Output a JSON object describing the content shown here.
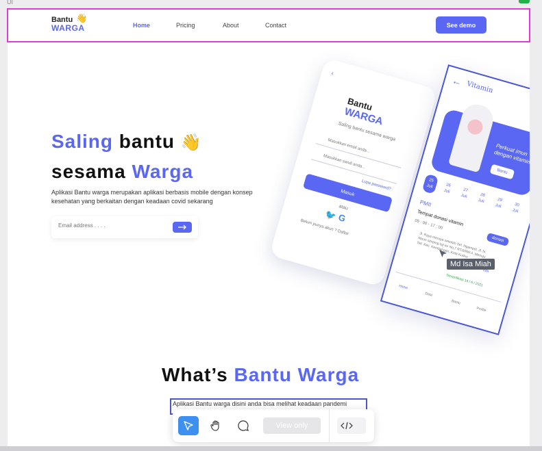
{
  "canvas": {
    "frame_label": "UI"
  },
  "nav": {
    "logo_line1": "Bantu",
    "logo_line2": "WARGA",
    "items": [
      {
        "label": "Home",
        "active": true
      },
      {
        "label": "Pricing",
        "active": false
      },
      {
        "label": "About",
        "active": false
      },
      {
        "label": "Contact",
        "active": false
      }
    ],
    "cta_label": "See demo"
  },
  "hero": {
    "title_part1": "Saling",
    "title_part2": "bantu",
    "title_part3": "sesama",
    "title_part4": "Warga",
    "description": "Aplikasi Bantu warga merupakan aplikasi berbasis mobile dengan konsep kesehatan yang berkaitan dengan keadaan covid sekarang",
    "email_placeholder": "Email address . . . ."
  },
  "phone_login": {
    "logo_line1": "Bantu",
    "logo_line2": "WARGA",
    "tagline": "Saling bantu sesama warga",
    "email_placeholder": "Masukkan email anda...",
    "password_placeholder": "Masukkan sandi anda...",
    "forgot": "Lupa password?",
    "submit": "Masuk",
    "or": "atau",
    "register": "Belum punya akun ? Daftar"
  },
  "phone_vitamin": {
    "title": "Vitamin",
    "banner_text": "Perkuat imun dengan vitamin",
    "banner_btn": "Bantu",
    "dates": [
      {
        "day": "25",
        "month": "Juli"
      },
      {
        "day": "26",
        "month": "Juli"
      },
      {
        "day": "27",
        "month": "Juli"
      },
      {
        "day": "28",
        "month": "Juli"
      },
      {
        "day": "29",
        "month": "Juli"
      },
      {
        "day": "30",
        "month": "Juli"
      }
    ],
    "org": "PMII",
    "card_title": "Tempat donasi vitamin",
    "time": "05 : 00 - 17 : 00",
    "address": "Jl. Raya merupa sekolah Sel. Ngampel, Jl. N. Moon simping loji lor No.7 RT.6/RW.4, Menuju Sel. Kec. Kembangan, Kota Kudus",
    "donate_btn": "donasi",
    "edit": "edit",
    "status": "Terverifikasi 14 / 6 / 2021",
    "tabs": [
      "Home",
      "Data",
      "Bantu",
      "Profile"
    ]
  },
  "tooltip": {
    "text": "Md Isa Miah"
  },
  "section2": {
    "title_part1": "What’s",
    "title_part2": "Bantu Warga",
    "description": "Aplikasi Bantu warga disini anda bisa melihat keadaan pandemi"
  },
  "toolbar": {
    "view_only": "View only"
  }
}
